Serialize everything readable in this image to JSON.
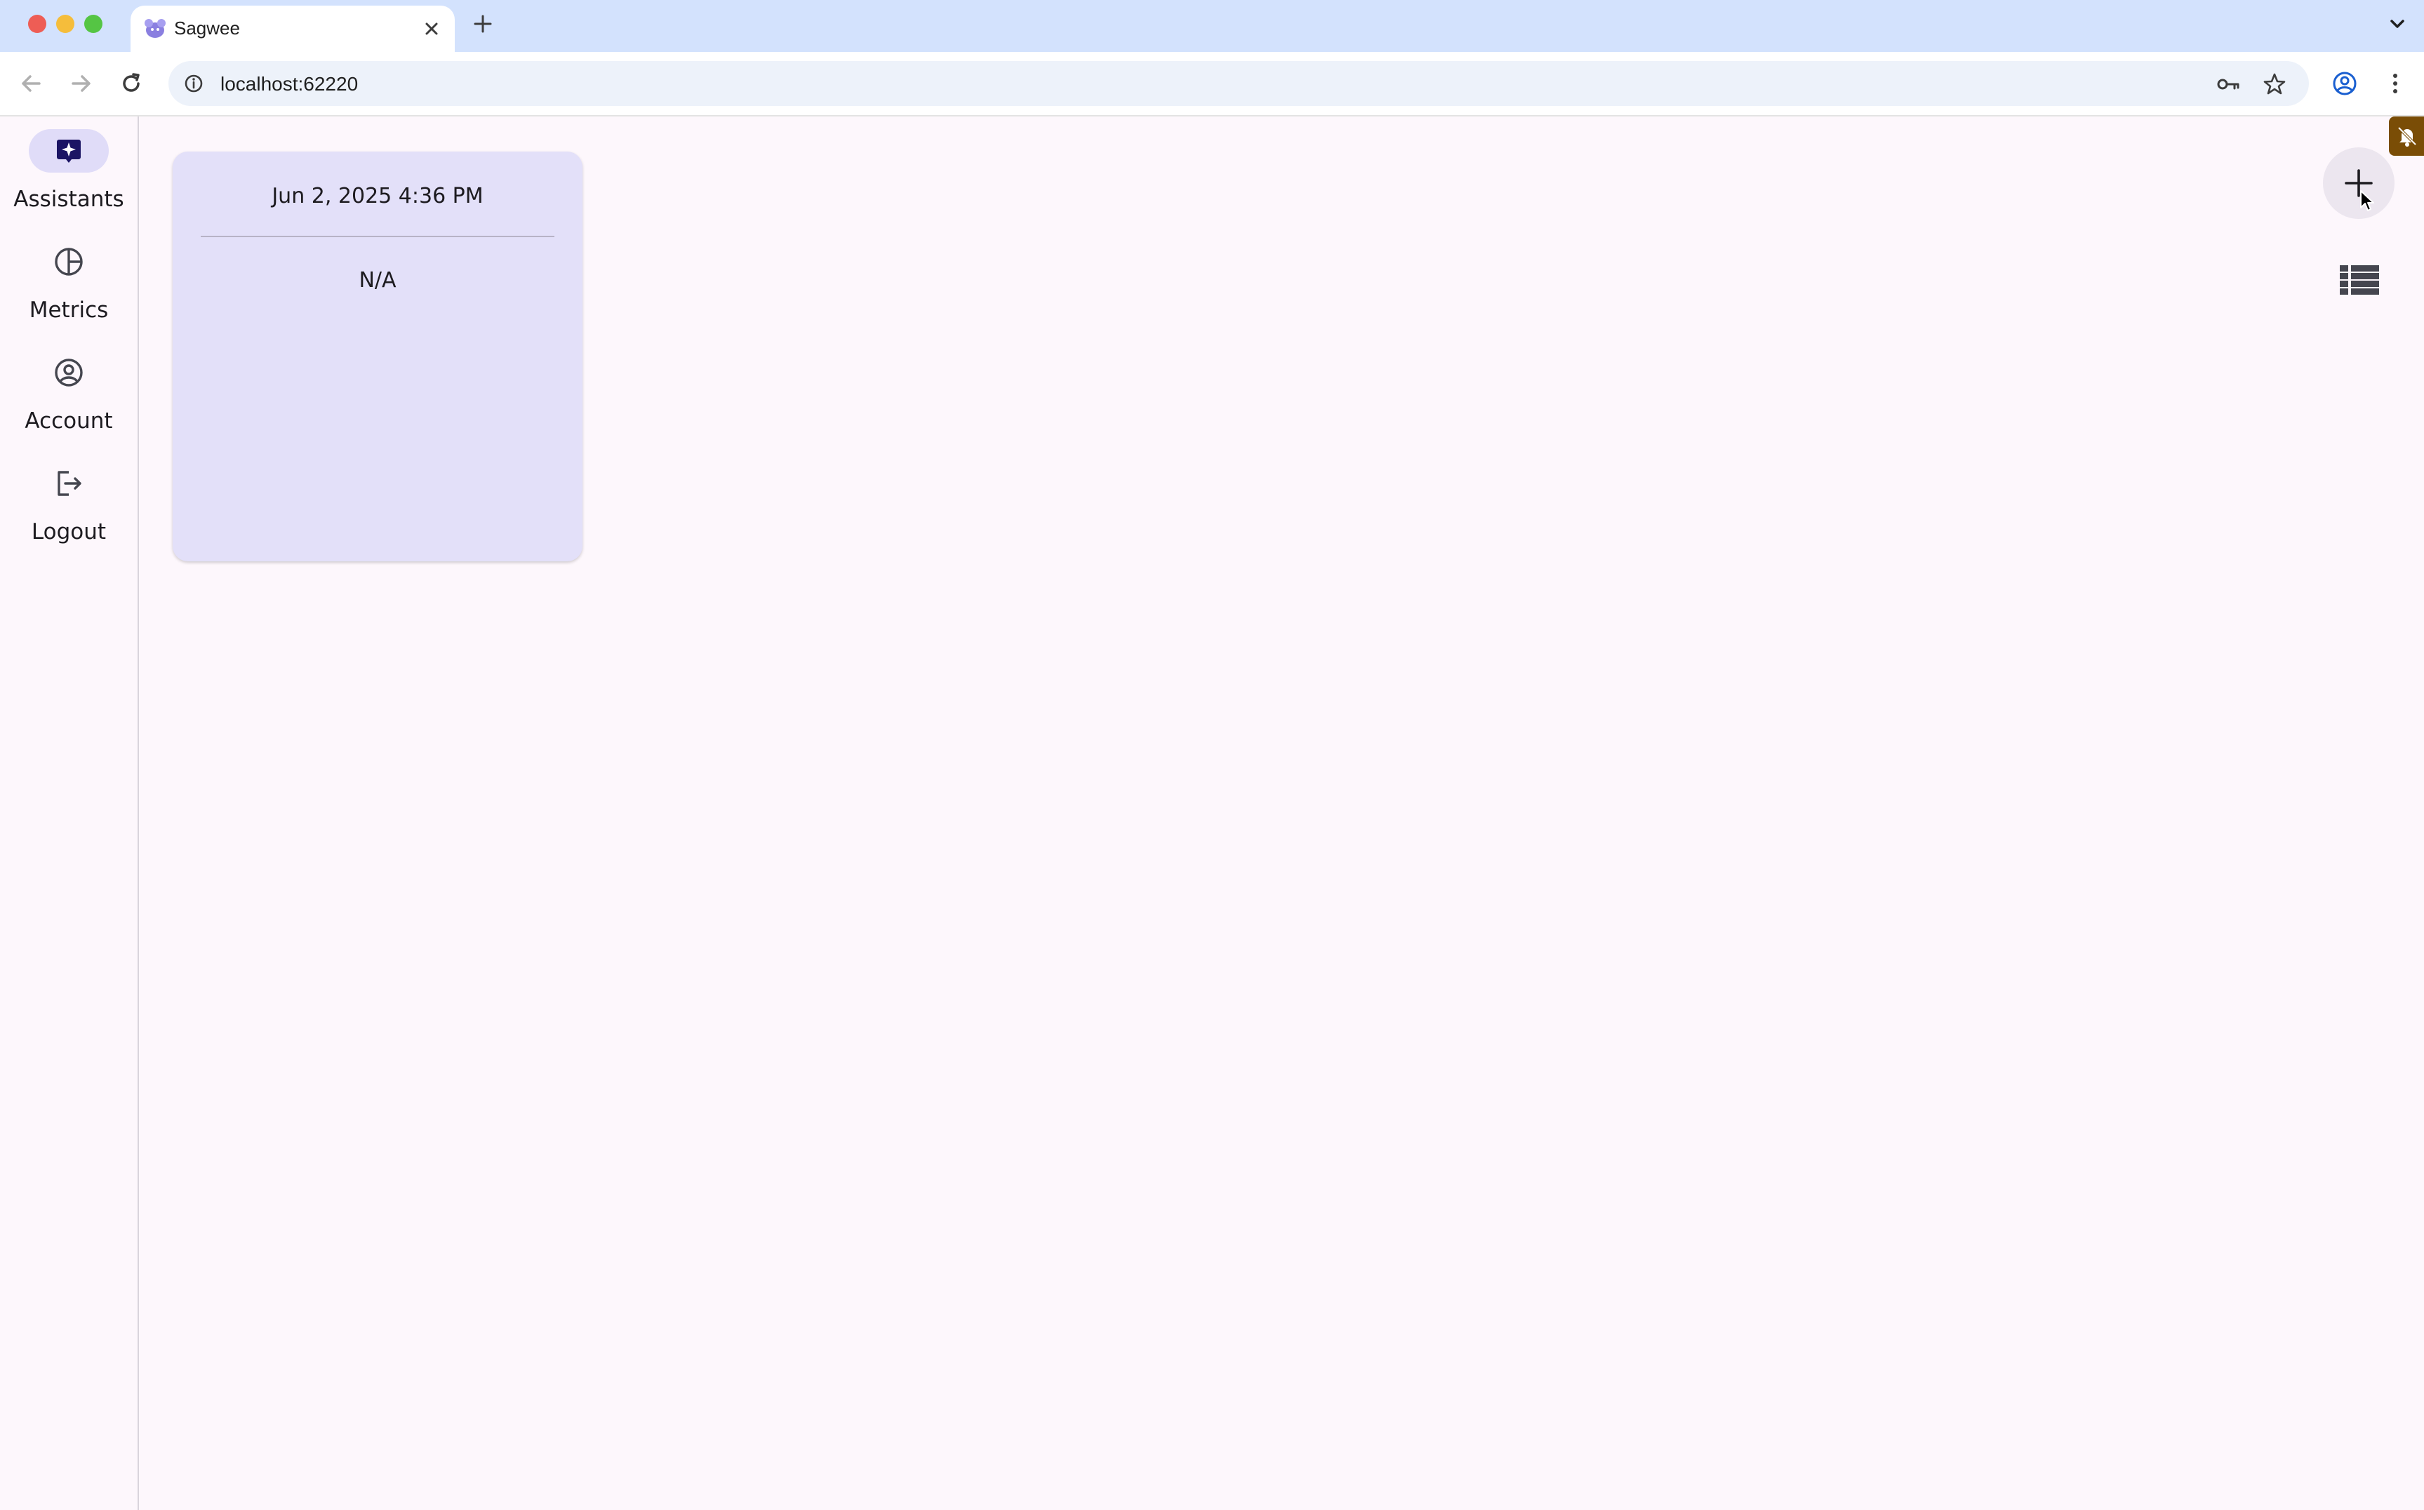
{
  "browser": {
    "tab_title": "Sagwee",
    "url": "localhost:62220"
  },
  "sidebar": {
    "items": [
      {
        "label": "Assistants",
        "icon": "assistant-sparkle-icon",
        "active": true
      },
      {
        "label": "Metrics",
        "icon": "pie-chart-icon",
        "active": false
      },
      {
        "label": "Account",
        "icon": "account-circle-icon",
        "active": false
      },
      {
        "label": "Logout",
        "icon": "logout-icon",
        "active": false
      }
    ]
  },
  "main": {
    "cards": [
      {
        "date": "Jun 2, 2025 4:36 PM",
        "value": "N/A"
      }
    ]
  },
  "colors": {
    "accent": "#e0dcf8",
    "card_background": "#e3e0f9",
    "page_background": "#fdf7fc",
    "notification_badge": "#7a4d06"
  }
}
